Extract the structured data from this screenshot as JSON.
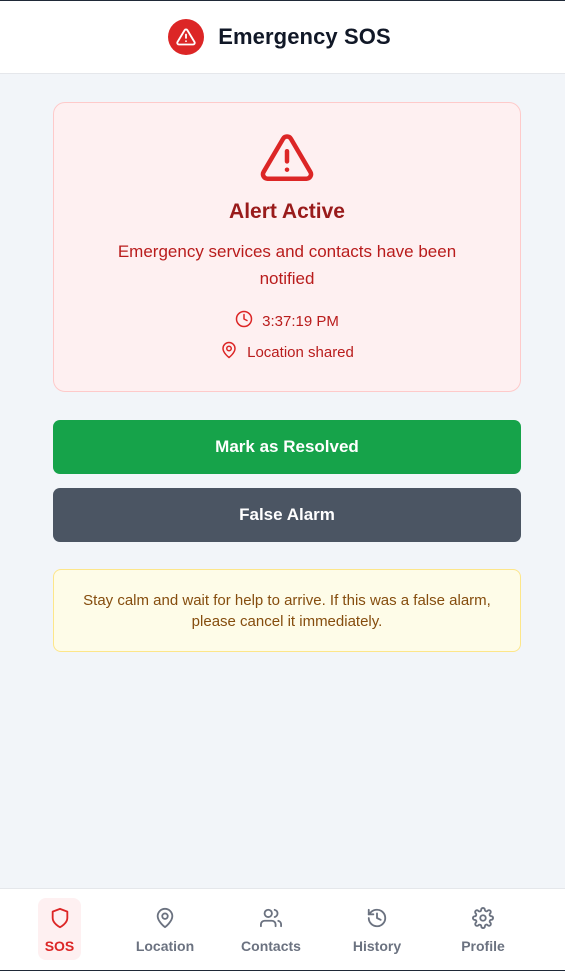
{
  "header": {
    "title": "Emergency SOS",
    "icon": "warning-triangle-icon",
    "accent": "#dc2626"
  },
  "alert": {
    "icon": "warning-triangle-icon",
    "title": "Alert Active",
    "message": "Emergency services and contacts have been notified",
    "time": "3:37:19 PM",
    "location": "Location shared",
    "colors": {
      "background": "#fef0f1",
      "text": "#b91c1c"
    }
  },
  "actions": {
    "resolve_label": "Mark as Resolved",
    "false_alarm_label": "False Alarm",
    "colors": {
      "resolve": "#16a34a",
      "false_alarm": "#4b5563"
    }
  },
  "notice": {
    "text": "Stay calm and wait for help to arrive. If this was a false alarm, please cancel it immediately."
  },
  "nav": {
    "items": [
      {
        "label": "SOS",
        "icon": "shield-icon",
        "active": true
      },
      {
        "label": "Location",
        "icon": "map-pin-icon",
        "active": false
      },
      {
        "label": "Contacts",
        "icon": "users-icon",
        "active": false
      },
      {
        "label": "History",
        "icon": "history-icon",
        "active": false
      },
      {
        "label": "Profile",
        "icon": "gear-icon",
        "active": false
      }
    ]
  }
}
